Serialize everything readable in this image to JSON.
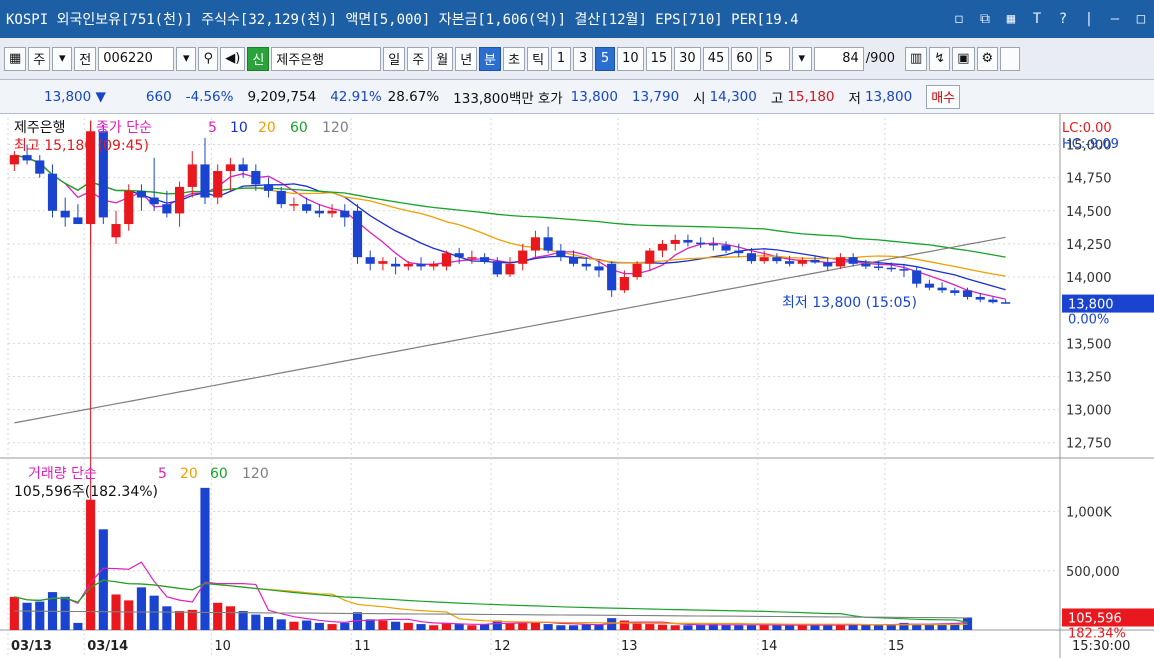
{
  "titlebar": {
    "text": "KOSPI 외국인보유[751(천)] 주식수[32,129(천)] 액면[5,000] 자본금[1,606(억)] 결산[12월] EPS[710] PER[19.4",
    "buttons": [
      "◻",
      "⧉",
      "▦",
      "T",
      "?",
      "|",
      "—",
      "□"
    ]
  },
  "toolbar": {
    "menu_glyph": "▦",
    "mode1": "주",
    "mode2": "전",
    "code": "006220",
    "new_label": "신",
    "stock_name": "제주은행",
    "periods": [
      "일",
      "주",
      "월",
      "년",
      "분",
      "초",
      "틱"
    ],
    "selected_period": "분",
    "intervals": [
      "1",
      "3",
      "5",
      "10",
      "15",
      "30",
      "45",
      "60"
    ],
    "selected_interval": "5",
    "interval_value": "5",
    "count": "84",
    "count_total": "/900"
  },
  "infobar": {
    "price": "13,800 ▼",
    "change": "660",
    "change_pct": "-4.56%",
    "volume": "9,209,754",
    "pct1": "42.91%",
    "pct2": "28.67%",
    "amount": "133,800백만",
    "quote_label": "호가",
    "ask": "13,800",
    "bid": "13,790",
    "open_label": "시",
    "open": "14,300",
    "high_label": "고",
    "high": "15,180",
    "low_label": "저",
    "low": "13,800",
    "trade_label": "매수"
  },
  "chart_data": {
    "type": "candlestick",
    "price_panel": {
      "title": "제주은행",
      "legend_label": "종가 단순",
      "ma_periods": [
        "5",
        "10",
        "20",
        "60",
        "120"
      ],
      "ma_colors": [
        "#e020c0",
        "#1b2fd0",
        "#f0a000",
        "#17a329",
        "#7f7f7f"
      ],
      "high_annotation": "최고 15,180 (09:45)",
      "low_annotation": "최저 13,800 (15:05)",
      "lc": "LC:0.00",
      "hc": "HC:-9.09",
      "y_ticks": [
        "15,000",
        "14,750",
        "14,500",
        "14,250",
        "14,000",
        "13,500",
        "13,250",
        "13,000",
        "12,750"
      ],
      "y_tick_values": [
        15000,
        14750,
        14500,
        14250,
        14000,
        13500,
        13250,
        13000,
        12750
      ],
      "ylim": [
        12650,
        15200
      ],
      "current_price": "13,800",
      "current_value": 13800,
      "current_pct": "0.00%"
    },
    "volume_panel": {
      "legend_label": "거래량 단순",
      "ma_periods": [
        "5",
        "20",
        "60",
        "120"
      ],
      "ma_colors": [
        "#e020c0",
        "#f0a000",
        "#17a329",
        "#7f7f7f"
      ],
      "summary": "105,596주(182.34%)",
      "y_ticks": [
        "1,000K",
        "500,000"
      ],
      "y_tick_values": [
        1000000,
        500000
      ],
      "ylim": [
        0,
        1300000
      ],
      "current_volume": "105,596",
      "current_value": 105596,
      "current_pct": "182.34%"
    },
    "x_labels": [
      "03/13",
      "03/14",
      "10",
      "11",
      "12",
      "13",
      "14",
      "15",
      "15:30:00"
    ],
    "x_label_index": [
      0,
      6,
      16,
      27,
      38,
      48,
      59,
      69
    ],
    "candles": [
      {
        "o": 14850,
        "h": 14950,
        "l": 14800,
        "c": 14920
      },
      {
        "o": 14920,
        "h": 15000,
        "l": 14850,
        "c": 14880
      },
      {
        "o": 14880,
        "h": 14920,
        "l": 14750,
        "c": 14780
      },
      {
        "o": 14780,
        "h": 14850,
        "l": 14450,
        "c": 14500
      },
      {
        "o": 14500,
        "h": 14600,
        "l": 14380,
        "c": 14450
      },
      {
        "o": 14450,
        "h": 14550,
        "l": 14400,
        "c": 14400
      },
      {
        "o": 14400,
        "h": 15180,
        "l": 14250,
        "c": 15100
      },
      {
        "o": 15100,
        "h": 15150,
        "l": 14400,
        "c": 14450
      },
      {
        "o": 14300,
        "h": 14500,
        "l": 14250,
        "c": 14400
      },
      {
        "o": 14400,
        "h": 14700,
        "l": 14350,
        "c": 14650
      },
      {
        "o": 14650,
        "h": 14700,
        "l": 14500,
        "c": 14600
      },
      {
        "o": 14600,
        "h": 14900,
        "l": 14500,
        "c": 14550
      },
      {
        "o": 14550,
        "h": 14650,
        "l": 14450,
        "c": 14480
      },
      {
        "o": 14480,
        "h": 14720,
        "l": 14380,
        "c": 14680
      },
      {
        "o": 14680,
        "h": 14950,
        "l": 14600,
        "c": 14850
      },
      {
        "o": 14850,
        "h": 15050,
        "l": 14550,
        "c": 14600
      },
      {
        "o": 14600,
        "h": 14850,
        "l": 14550,
        "c": 14800
      },
      {
        "o": 14800,
        "h": 14900,
        "l": 14650,
        "c": 14850
      },
      {
        "o": 14850,
        "h": 14900,
        "l": 14750,
        "c": 14800
      },
      {
        "o": 14800,
        "h": 14850,
        "l": 14650,
        "c": 14700
      },
      {
        "o": 14700,
        "h": 14750,
        "l": 14600,
        "c": 14650
      },
      {
        "o": 14650,
        "h": 14680,
        "l": 14520,
        "c": 14550
      },
      {
        "o": 14550,
        "h": 14600,
        "l": 14500,
        "c": 14550
      },
      {
        "o": 14550,
        "h": 14600,
        "l": 14480,
        "c": 14500
      },
      {
        "o": 14500,
        "h": 14550,
        "l": 14450,
        "c": 14480
      },
      {
        "o": 14480,
        "h": 14550,
        "l": 14450,
        "c": 14500
      },
      {
        "o": 14500,
        "h": 14550,
        "l": 14380,
        "c": 14450
      },
      {
        "o": 14500,
        "h": 14550,
        "l": 14100,
        "c": 14150
      },
      {
        "o": 14150,
        "h": 14200,
        "l": 14050,
        "c": 14100
      },
      {
        "o": 14100,
        "h": 14150,
        "l": 14050,
        "c": 14120
      },
      {
        "o": 14100,
        "h": 14150,
        "l": 14020,
        "c": 14080
      },
      {
        "o": 14080,
        "h": 14120,
        "l": 14050,
        "c": 14100
      },
      {
        "o": 14100,
        "h": 14150,
        "l": 14050,
        "c": 14080
      },
      {
        "o": 14080,
        "h": 14120,
        "l": 14050,
        "c": 14100
      },
      {
        "o": 14080,
        "h": 14200,
        "l": 14050,
        "c": 14180
      },
      {
        "o": 14180,
        "h": 14220,
        "l": 14100,
        "c": 14150
      },
      {
        "o": 14150,
        "h": 14200,
        "l": 14100,
        "c": 14150
      },
      {
        "o": 14150,
        "h": 14180,
        "l": 14100,
        "c": 14120
      },
      {
        "o": 14120,
        "h": 14150,
        "l": 14000,
        "c": 14020
      },
      {
        "o": 14020,
        "h": 14150,
        "l": 14000,
        "c": 14100
      },
      {
        "o": 14100,
        "h": 14250,
        "l": 14050,
        "c": 14200
      },
      {
        "o": 14200,
        "h": 14350,
        "l": 14150,
        "c": 14300
      },
      {
        "o": 14300,
        "h": 14380,
        "l": 14180,
        "c": 14200
      },
      {
        "o": 14200,
        "h": 14250,
        "l": 14120,
        "c": 14150
      },
      {
        "o": 14150,
        "h": 14200,
        "l": 14080,
        "c": 14100
      },
      {
        "o": 14100,
        "h": 14150,
        "l": 14050,
        "c": 14080
      },
      {
        "o": 14080,
        "h": 14120,
        "l": 14000,
        "c": 14050
      },
      {
        "o": 14100,
        "h": 14120,
        "l": 13850,
        "c": 13900
      },
      {
        "o": 13900,
        "h": 14050,
        "l": 13880,
        "c": 14000
      },
      {
        "o": 14000,
        "h": 14120,
        "l": 13980,
        "c": 14100
      },
      {
        "o": 14100,
        "h": 14220,
        "l": 14050,
        "c": 14200
      },
      {
        "o": 14200,
        "h": 14280,
        "l": 14150,
        "c": 14250
      },
      {
        "o": 14250,
        "h": 14320,
        "l": 14200,
        "c": 14280
      },
      {
        "o": 14280,
        "h": 14320,
        "l": 14230,
        "c": 14260
      },
      {
        "o": 14260,
        "h": 14300,
        "l": 14220,
        "c": 14250
      },
      {
        "o": 14250,
        "h": 14300,
        "l": 14200,
        "c": 14240
      },
      {
        "o": 14240,
        "h": 14270,
        "l": 14180,
        "c": 14200
      },
      {
        "o": 14200,
        "h": 14250,
        "l": 14150,
        "c": 14180
      },
      {
        "o": 14180,
        "h": 14220,
        "l": 14100,
        "c": 14120
      },
      {
        "o": 14120,
        "h": 14200,
        "l": 14100,
        "c": 14150
      },
      {
        "o": 14150,
        "h": 14180,
        "l": 14100,
        "c": 14120
      },
      {
        "o": 14120,
        "h": 14160,
        "l": 14080,
        "c": 14100
      },
      {
        "o": 14100,
        "h": 14150,
        "l": 14080,
        "c": 14130
      },
      {
        "o": 14130,
        "h": 14160,
        "l": 14100,
        "c": 14110
      },
      {
        "o": 14110,
        "h": 14150,
        "l": 14050,
        "c": 14080
      },
      {
        "o": 14080,
        "h": 14180,
        "l": 14060,
        "c": 14150
      },
      {
        "o": 14150,
        "h": 14180,
        "l": 14080,
        "c": 14100
      },
      {
        "o": 14100,
        "h": 14130,
        "l": 14060,
        "c": 14080
      },
      {
        "o": 14080,
        "h": 14120,
        "l": 14050,
        "c": 14070
      },
      {
        "o": 14070,
        "h": 14110,
        "l": 14040,
        "c": 14060
      },
      {
        "o": 14060,
        "h": 14100,
        "l": 14000,
        "c": 14050
      },
      {
        "o": 14050,
        "h": 14080,
        "l": 13920,
        "c": 13950
      },
      {
        "o": 13950,
        "h": 13980,
        "l": 13900,
        "c": 13920
      },
      {
        "o": 13920,
        "h": 13960,
        "l": 13880,
        "c": 13900
      },
      {
        "o": 13900,
        "h": 13920,
        "l": 13860,
        "c": 13880
      },
      {
        "o": 13900,
        "h": 13920,
        "l": 13830,
        "c": 13850
      },
      {
        "o": 13850,
        "h": 13880,
        "l": 13810,
        "c": 13830
      },
      {
        "o": 13830,
        "h": 13850,
        "l": 13800,
        "c": 13810
      },
      {
        "o": 13810,
        "h": 13830,
        "l": 13800,
        "c": 13800
      }
    ],
    "volume": [
      280000,
      230000,
      240000,
      320000,
      280000,
      60000,
      1100000,
      850000,
      300000,
      250000,
      360000,
      290000,
      200000,
      160000,
      170000,
      1200000,
      230000,
      200000,
      160000,
      130000,
      110000,
      90000,
      70000,
      80000,
      60000,
      50000,
      60000,
      150000,
      90000,
      80000,
      70000,
      60000,
      50000,
      40000,
      60000,
      50000,
      40000,
      50000,
      80000,
      60000,
      70000,
      60000,
      50000,
      40000,
      40000,
      50000,
      45000,
      100000,
      80000,
      60000,
      50000,
      45000,
      40000,
      40000,
      45000,
      50000,
      45000,
      40000,
      40000,
      45000,
      40000,
      40000,
      45000,
      40000,
      40000,
      45000,
      50000,
      45000,
      40000,
      50000,
      60000,
      50000,
      45000,
      55000,
      60000,
      105596
    ],
    "ma120_start": 12900,
    "ma120_end": 14300
  }
}
